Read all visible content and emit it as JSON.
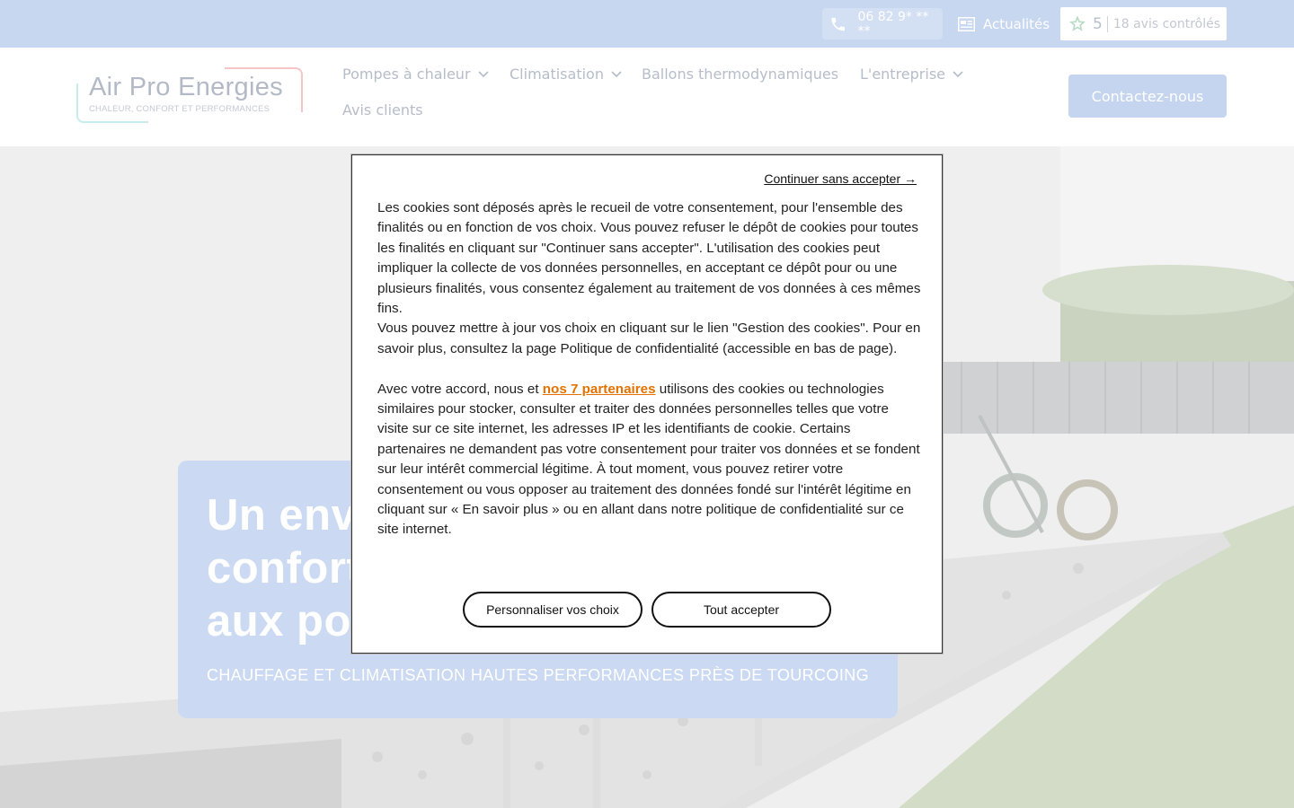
{
  "topbar": {
    "phone": "06 82 9* ** **",
    "news_label": "Actualités",
    "rating_score": "5",
    "rating_label": "18 avis contrôlés"
  },
  "header": {
    "logo_title": "Air Pro Energies",
    "logo_subtitle": "CHALEUR, CONFORT ET PERFORMANCES",
    "nav": [
      {
        "label": "Pompes à chaleur",
        "has_dropdown": true
      },
      {
        "label": "Climatisation",
        "has_dropdown": true
      },
      {
        "label": "Ballons thermodynamiques",
        "has_dropdown": false
      },
      {
        "label": "L'entreprise",
        "has_dropdown": true
      },
      {
        "label": "Avis clients",
        "has_dropdown": false
      }
    ],
    "cta_label": "Contactez-nous"
  },
  "hero": {
    "title_lines": [
      "Un env",
      "confort",
      "aux po"
    ],
    "subtitle": "CHAUFFAGE ET CLIMATISATION HAUTES PERFORMANCES PRÈS DE TOURCOING"
  },
  "cookie_modal": {
    "continue_label": "Continuer sans accepter →",
    "paragraph_1": "Les cookies sont déposés après le recueil de votre consentement, pour l'ensemble des finalités ou en fonction de vos choix. Vous pouvez refuser le dépôt de cookies pour toutes les finalités en cliquant sur \"Continuer sans accepter\". L'utilisation des cookies peut impliquer la collecte de vos données personnelles, en acceptant ce dépôt pour ou une plusieurs finalités, vous consentez également au traitement de vos données à ces mêmes fins.",
    "paragraph_2": "Vous pouvez mettre à jour vos choix en cliquant sur le lien \"Gestion des cookies\". Pour en savoir plus, consultez la page Politique de confidentialité (accessible en bas de page).",
    "paragraph_3_before": "Avec votre accord, nous et ",
    "partners_link": "nos 7 partenaires",
    "paragraph_3_after": " utilisons des cookies ou technologies similaires pour stocker, consulter et traiter des données personnelles telles que votre visite sur ce site internet, les adresses IP et les identifiants de cookie. Certains partenaires ne demandent pas votre consentement pour traiter vos données et se fondent sur leur intérêt commercial légitime. À tout moment, vous pouvez retirer votre consentement ou vous opposer au traitement des données fondé sur l'intérêt légitime en cliquant sur « En savoir plus » ou en allant dans notre politique de confidentialité sur ce site internet.",
    "customize_label": "Personnaliser vos choix",
    "accept_label": "Tout accepter"
  },
  "icons": {
    "phone": "phone-icon",
    "news": "newspaper-icon",
    "rating": "star-rating-icon",
    "dropdown": "chevron-down-icon"
  },
  "colors": {
    "topbar_bg": "#c7d7f0",
    "cta_bg": "#c5d5ef",
    "link_orange": "#e27200"
  }
}
